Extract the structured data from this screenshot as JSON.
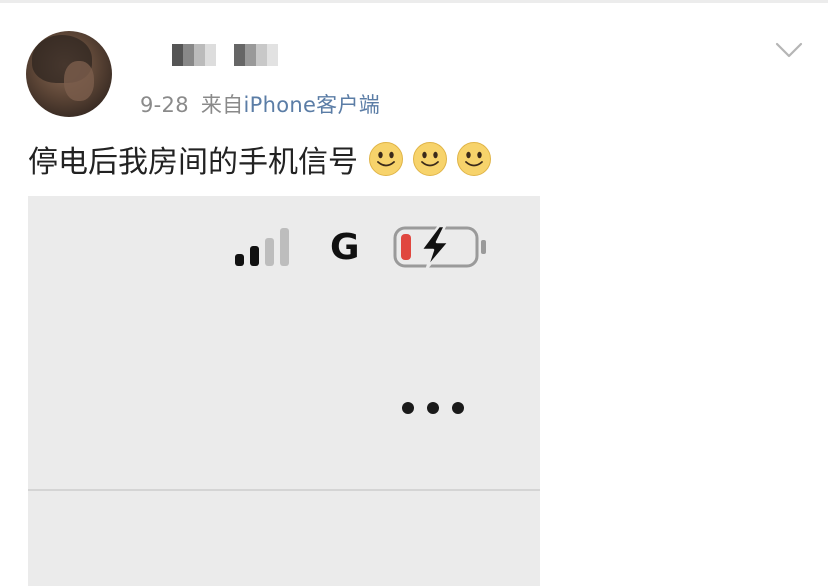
{
  "post": {
    "date": "9-28",
    "source_prefix": "来自",
    "source_client": "iPhone客户端",
    "text": "停电后我房间的手机信号",
    "emojis": [
      "smile-emoji",
      "smile-emoji",
      "smile-emoji"
    ]
  },
  "user": {
    "avatar": "avatar-photo",
    "name": "censored-username"
  },
  "screenshot": {
    "network_type": "G",
    "signal_bars_active": 2,
    "signal_bars_total": 4,
    "battery_level": 0.1,
    "battery_charging": true,
    "colors": {
      "battery_low": "#e0473f",
      "link": "#5b7da6"
    }
  },
  "icons": {
    "dropdown": "chevron-down-icon",
    "more": "more-dots-icon",
    "signal": "signal-bars-icon",
    "battery": "battery-charging-icon"
  }
}
